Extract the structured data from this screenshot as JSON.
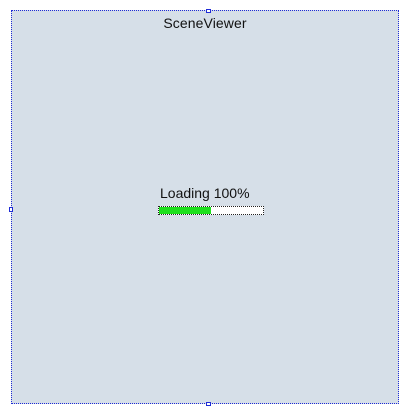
{
  "viewer": {
    "title": "SceneViewer",
    "loading_label": "Loading 100%",
    "progress_fraction": 0.5
  },
  "colors": {
    "background": "#d6dfe8",
    "selection_border": "#1f2bd6",
    "progress_fill": "#1ee01e"
  }
}
